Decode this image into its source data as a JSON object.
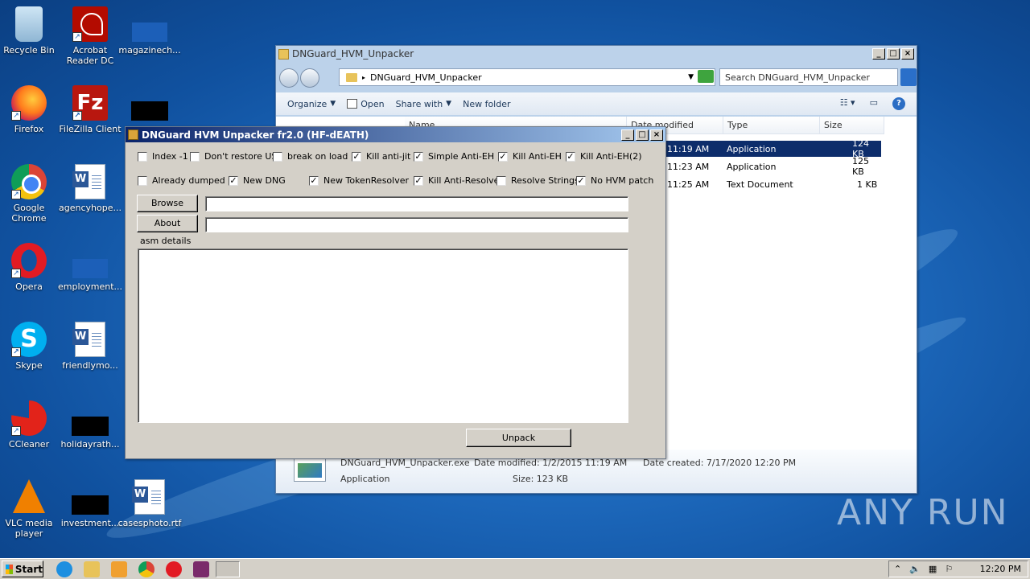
{
  "desktop": {
    "icons": [
      {
        "label": "Recycle Bin"
      },
      {
        "label": "Acrobat Reader DC"
      },
      {
        "label": "magazinech..."
      },
      {
        "label": "Firefox"
      },
      {
        "label": "FileZilla Client"
      },
      {
        "label": "Google Chrome"
      },
      {
        "label": "agencyhope..."
      },
      {
        "label": "Opera"
      },
      {
        "label": "employment..."
      },
      {
        "label": "Skype"
      },
      {
        "label": "friendlymo..."
      },
      {
        "label": "CCleaner"
      },
      {
        "label": "holidayrath..."
      },
      {
        "label": "VLC media player"
      },
      {
        "label": "investment..."
      },
      {
        "label": "casesphoto.rtf"
      }
    ]
  },
  "explorer": {
    "title": "DNGuard_HVM_Unpacker",
    "address": "DNGuard_HVM_Unpacker",
    "search_placeholder": "Search DNGuard_HVM_Unpacker",
    "toolbar": {
      "organize": "Organize",
      "open": "Open",
      "share": "Share with",
      "new_folder": "New folder"
    },
    "columns": {
      "name": "Name",
      "date": "Date modified",
      "type": "Type",
      "size": "Size"
    },
    "rows": [
      {
        "time": "11:19 AM",
        "type": "Application",
        "size": "124 KB"
      },
      {
        "time": "11:23 AM",
        "type": "Application",
        "size": "125 KB"
      },
      {
        "time": "11:25 AM",
        "type": "Text Document",
        "size": "1 KB"
      }
    ],
    "details": {
      "filename": "DNGuard_HVM_Unpacker.exe",
      "date_modified": "Date modified: 1/2/2015 11:19 AM",
      "date_created": "Date created: 7/17/2020 12:20 PM",
      "kind": "Application",
      "size": "Size: 123 KB"
    }
  },
  "dng": {
    "title": "DNGuard HVM Unpacker fr2.0  (HF-dEATH)",
    "options_row1": [
      {
        "label": "Index -1",
        "checked": false
      },
      {
        "label": "Don't restore US",
        "checked": false
      },
      {
        "label": "break on load",
        "checked": false
      },
      {
        "label": "Kill anti-jit",
        "checked": true
      },
      {
        "label": "Simple Anti-EH",
        "checked": true
      },
      {
        "label": "Kill Anti-EH",
        "checked": true
      },
      {
        "label": "Kill Anti-EH(2)",
        "checked": true
      }
    ],
    "options_row2": [
      {
        "label": "Already dumped",
        "checked": false
      },
      {
        "label": "New DNG",
        "checked": true
      },
      {
        "label": "New TokenResolver",
        "checked": true
      },
      {
        "label": "Kill Anti-Resolver",
        "checked": true
      },
      {
        "label": "Resolve Strings",
        "checked": false
      },
      {
        "label": "No HVM patch",
        "checked": true
      }
    ],
    "browse_label": "Browse",
    "about_label": "About",
    "asm_label": "asm details",
    "unpack_label": "Unpack"
  },
  "taskbar": {
    "start_label": "Start",
    "clock": "12:20 PM"
  },
  "watermark": "ANY RUN"
}
